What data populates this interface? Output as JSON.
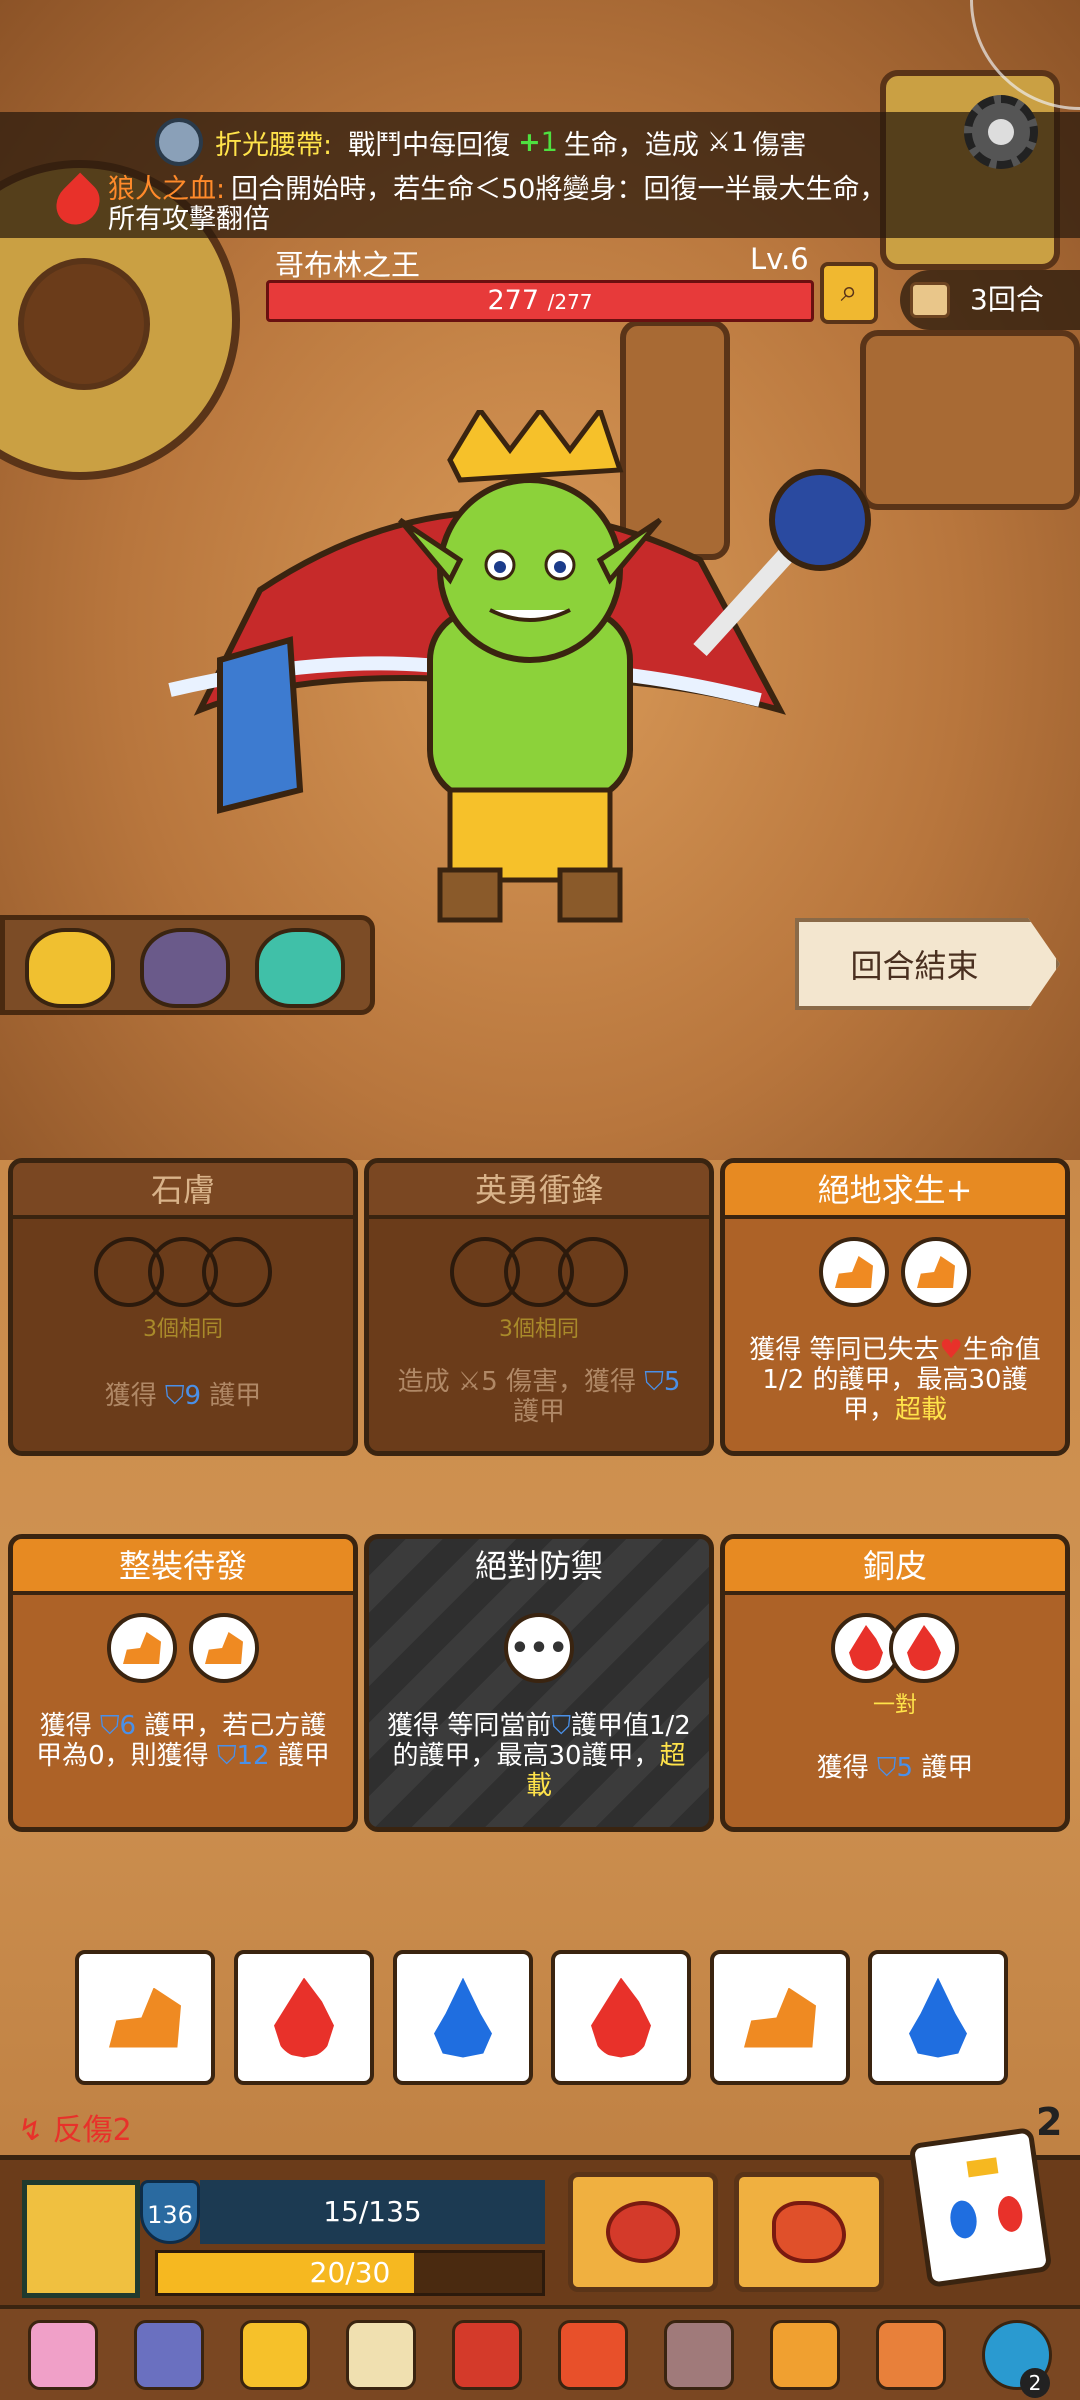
{
  "buffs": {
    "belt": {
      "name": "折光腰帶:",
      "text_a": "戰鬥中每回復",
      "heal_icon": "+",
      "heal_value": "1",
      "text_b": "生命，造成",
      "dmg_value": "1",
      "text_c": "傷害"
    },
    "werewolf": {
      "name": "狼人之血:",
      "line1": "回合開始時，若生命＜50將變身：回復一半最大生命，",
      "line2": "所有攻擊翻倍"
    }
  },
  "enemy": {
    "name": "哥布林之王",
    "level": "Lv.6",
    "hp_current": "277",
    "hp_max": "/277",
    "hp_fraction": 1.0
  },
  "round": {
    "label": "3回合"
  },
  "end_turn": {
    "label": "回合結束"
  },
  "cards": [
    {
      "title": "石膚",
      "requirement": "3個相同",
      "desc_a": "獲得",
      "armor": "9",
      "desc_b": "護甲",
      "state": "inactive"
    },
    {
      "title": "英勇衝鋒",
      "requirement": "3個相同",
      "desc_a": "造成",
      "dmg": "5",
      "desc_b": "傷害，獲得",
      "armor": "5",
      "desc_c": "護甲",
      "state": "inactive"
    },
    {
      "title": "絕地求生+",
      "desc_a": "獲得 等同已失去",
      "desc_b": "生命值",
      "desc_c": "1/2 的護甲，最高30護",
      "desc_d": "甲，",
      "keyword": "超載",
      "state": "active"
    },
    {
      "title": "整裝待發",
      "desc_a": "獲得",
      "armor": "6",
      "desc_b": "護甲，若己方護",
      "desc_c": "甲為0，則獲得",
      "armor2": "12",
      "desc_d": "護甲",
      "state": "active"
    },
    {
      "title": "絕對防禦",
      "slot_text": "•••",
      "desc_a": "獲得 等同當前",
      "desc_b": "護甲值1/2",
      "desc_c": "的護甲，最高30護甲，",
      "keyword_a": "超",
      "keyword_b": "載",
      "state": "dark"
    },
    {
      "title": "銅皮",
      "requirement": "一對",
      "desc_a": "獲得",
      "armor": "5",
      "desc_b": "護甲",
      "state": "active"
    }
  ],
  "dice_tray": [
    "stone",
    "flame",
    "drop",
    "flame",
    "stone",
    "drop"
  ],
  "status": {
    "bleed": "反傷2",
    "dice_remaining": "2"
  },
  "player": {
    "armor": "136",
    "hp": "15/135",
    "energy": "20/30",
    "energy_fraction": 0.667
  },
  "relic_badge": "2",
  "colors": {
    "accent": "#e78a22",
    "hp_red": "#e73a3a",
    "armor_blue": "#4a90e8",
    "highlight": "#ffe34a"
  }
}
